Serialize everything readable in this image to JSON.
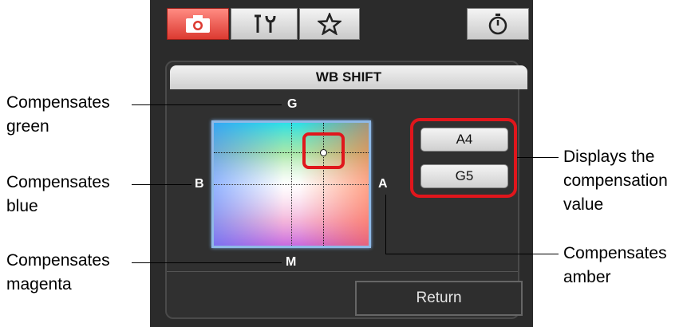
{
  "tabs": [
    {
      "icon": "camera-icon",
      "active": true
    },
    {
      "icon": "tools-icon",
      "active": false
    },
    {
      "icon": "star-icon",
      "active": false
    },
    {
      "icon": "timer-icon",
      "active": false
    }
  ],
  "panel": {
    "title": "WB SHIFT",
    "axes": {
      "top": "G",
      "left": "B",
      "right": "A",
      "bottom": "M"
    },
    "values": {
      "amber": "A4",
      "green": "G5"
    },
    "return_label": "Return"
  },
  "callouts": {
    "green": "Compensates\ngreen",
    "blue": "Compensates\nblue",
    "magenta": "Compensates\nmagenta",
    "value": "Displays the\ncompensation\nvalue",
    "amber": "Compensates\namber"
  },
  "colors": {
    "highlight": "#e0161c",
    "active_tab": "#dc3a31",
    "panel_bg": "#2b2b2b"
  }
}
